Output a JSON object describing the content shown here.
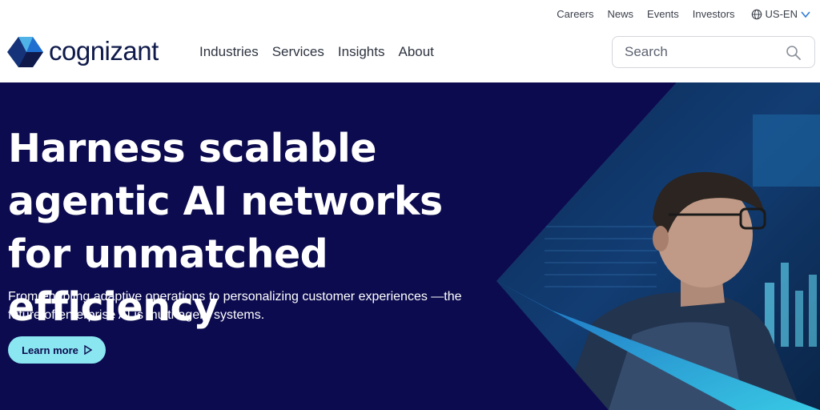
{
  "utility_nav": {
    "items": [
      "Careers",
      "News",
      "Events",
      "Investors"
    ],
    "language": "US-EN"
  },
  "brand": {
    "name": "cognizant"
  },
  "main_nav": {
    "items": [
      "Industries",
      "Services",
      "Insights",
      "About"
    ]
  },
  "search": {
    "placeholder": "Search"
  },
  "hero": {
    "title": "Harness scalable agentic AI networks for unmatched efficiency",
    "subtitle": "From enabling adaptive operations to personalizing customer experiences —the future of enterprise AI is multi-agent systems.",
    "cta_label": "Learn more"
  },
  "icons": {
    "globe": "globe-icon",
    "chevron": "chevron-down-icon",
    "search": "search-icon",
    "cta_arrow": "play-triangle-icon"
  },
  "colors": {
    "hero_background": "#0c0b4f",
    "brand_navy": "#0f1a4a",
    "cta_background": "#8ae6f0",
    "accent_blue": "#2f7bd6",
    "accent_purple": "#6a3fb5"
  }
}
